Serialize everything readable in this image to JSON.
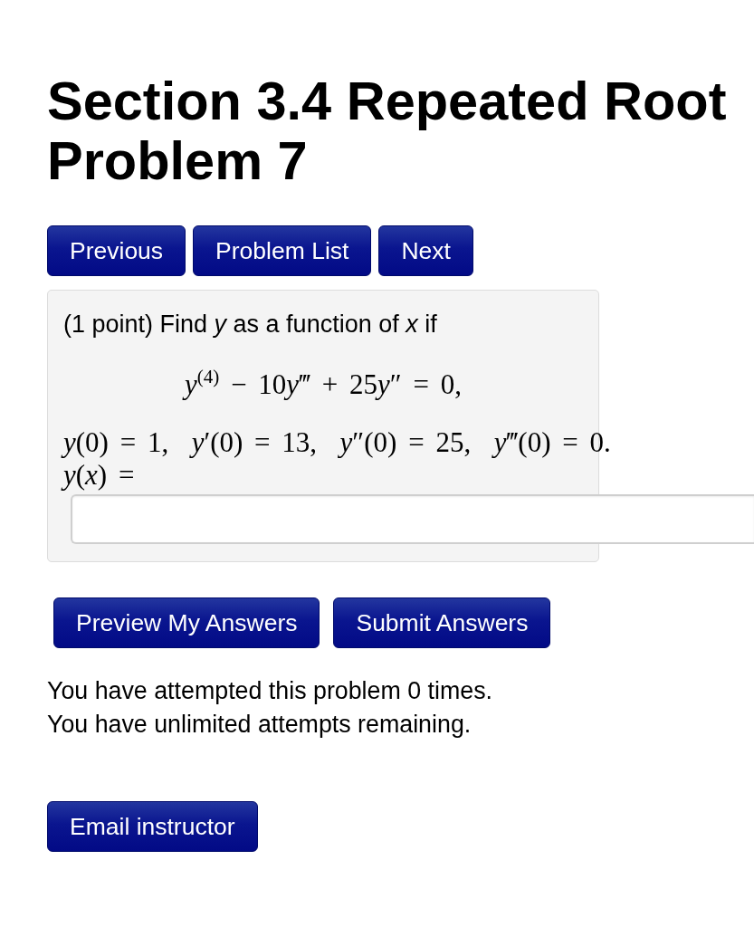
{
  "page_title": "Section 3.4 Repeated Root Problem 7",
  "nav_buttons": [
    "Previous",
    "Problem List",
    "Next"
  ],
  "problem": {
    "intro": "(1 point) Find *y* as a function of *x* if",
    "equation": [
      "*y*$^{(4)}$ − 10",
      "*y*‴ + 25",
      "*y*″ = 0,"
    ],
    "conditions": "*y*(0) = 1,  *y*′(0) = 13,  *y*″(0) = 25,  *y*‴(0) = 0.",
    "answer_label": "*y*(*x*) ="
  },
  "answer_buttons": [
    "Preview My Answers",
    "Submit Answers"
  ],
  "attempts": [
    "You have attempted this problem 0 times.",
    "You have unlimited attempts remaining."
  ],
  "email_button": "Email instructor"
}
